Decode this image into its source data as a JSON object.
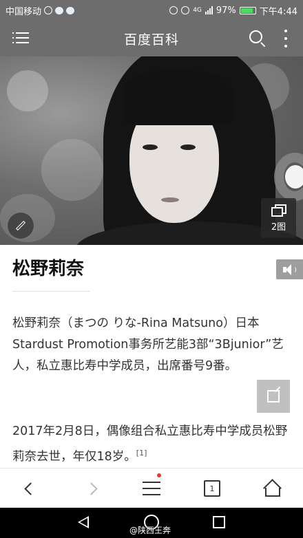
{
  "status_bar": {
    "carrier": "中国移动",
    "network": "4G",
    "battery": "97%",
    "time": "下午4:44"
  },
  "header": {
    "title": "百度百科"
  },
  "hero": {
    "image_count": "2图"
  },
  "article": {
    "title": "松野莉奈",
    "paragraph1": "松野莉奈（まつの りな-Rina Matsuno）日本Stardust Promotion事务所艺能3部“3Bjunior”艺人，私立惠比寿中学成员，出席番号9番。",
    "paragraph2": "2017年2月8日，偶像组合私立惠比寿中学成员松野莉奈去世，年仅18岁。",
    "citation": "[1]"
  },
  "toolbar": {
    "tabs_count": "1"
  },
  "watermark": "@陕西王奔",
  "colors": {
    "header_bg": "#6d6d6d",
    "notification_dot": "#e53935",
    "battery_fill": "#4cd964"
  }
}
